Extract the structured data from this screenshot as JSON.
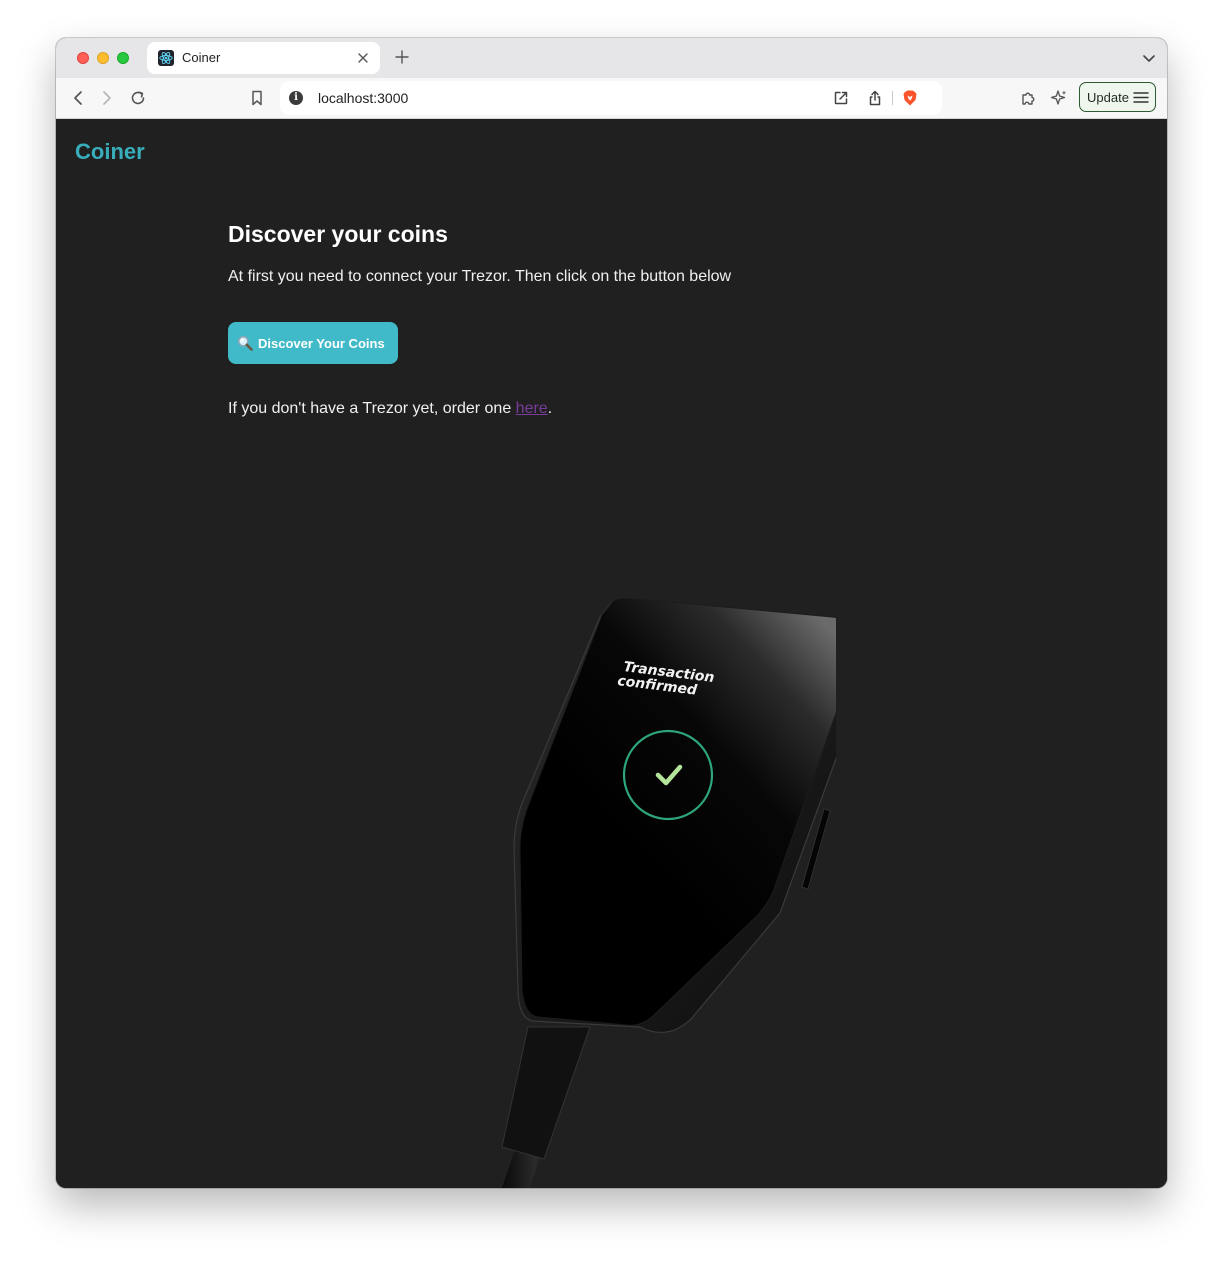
{
  "browser": {
    "tab": {
      "title": "Coiner"
    },
    "address_bar": {
      "url": "localhost:3000"
    },
    "update_button": {
      "label": "Update"
    }
  },
  "page": {
    "brand": "Coiner",
    "heading": "Discover your coins",
    "intro": "At first you need to connect your Trezor. Then click on the button below",
    "discover_button": {
      "label": "Discover Your Coins",
      "icon": "magnifier-icon"
    },
    "order_prefix": "If you don't have a Trezor yet, order one ",
    "order_link": "here",
    "order_suffix": ".",
    "device_image": {
      "screen_line1": "Transaction",
      "screen_line2": "confirmed"
    }
  },
  "colors": {
    "brand": "#39aebb",
    "button": "#40bac8",
    "page_background": "#202020",
    "link": "#7a3c9a",
    "check_ring": "#2ea67a"
  }
}
